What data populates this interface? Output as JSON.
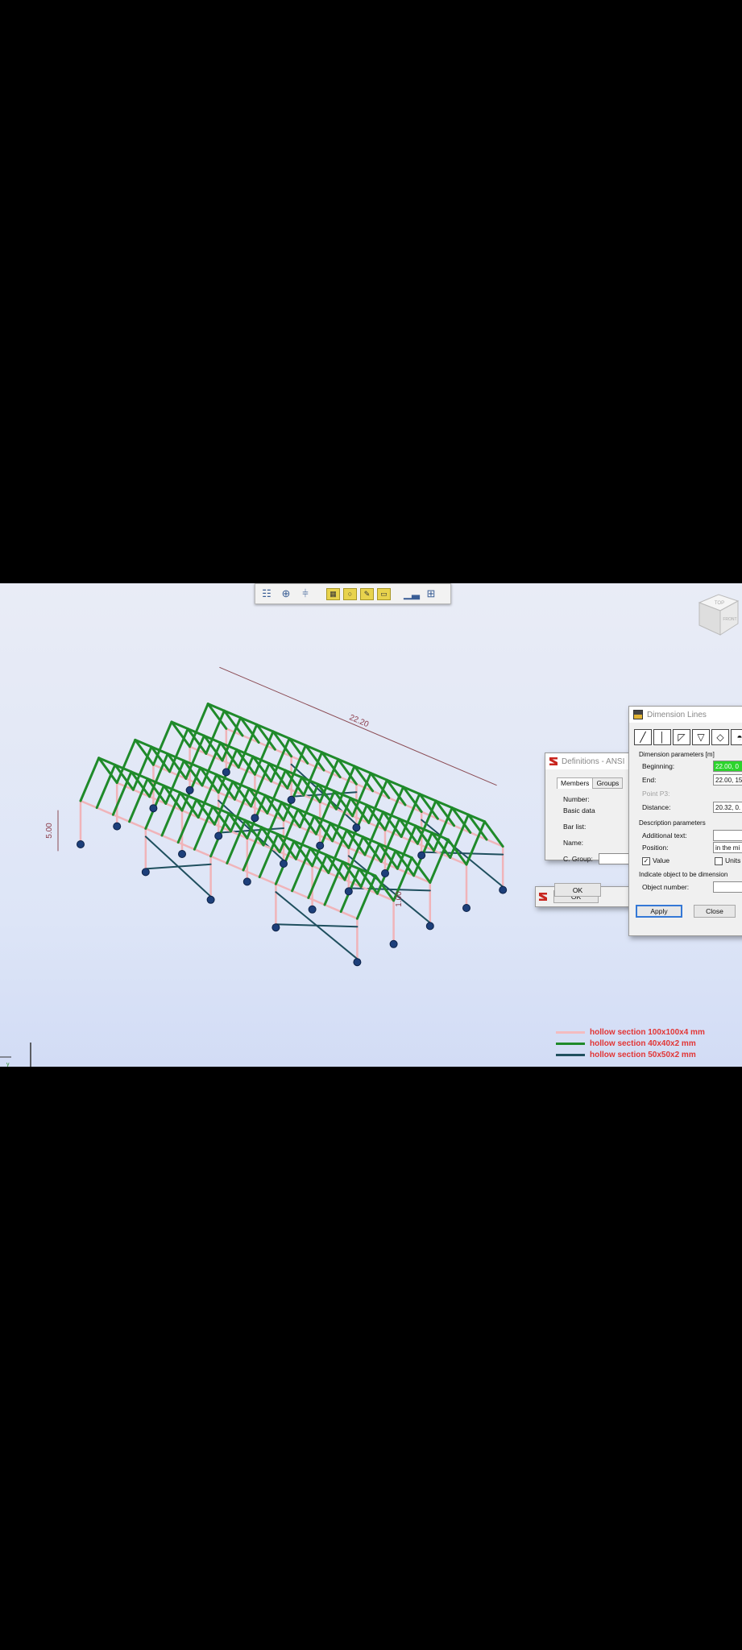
{
  "toolbar": {
    "icons": [
      "grid-icon",
      "node-icon",
      "bars-icon",
      "table-icon",
      "comment-icon",
      "edit-icon",
      "window-icon",
      "chart-icon",
      "frame-icon"
    ]
  },
  "viewcube": {
    "top_label": "TOP",
    "front_label": "FRONT"
  },
  "model": {
    "dim_length": "22.20",
    "dim_height": "5.00",
    "dim_small": "1.00"
  },
  "definitions_window": {
    "title": "Definitions - ANSI",
    "tabs": [
      "Members",
      "Groups"
    ],
    "labels": {
      "number": "Number:",
      "basic_data": "Basic data",
      "bar_list": "Bar list:",
      "name": "Name:",
      "c_group": "C. Group:"
    },
    "ok_label": "OK"
  },
  "dimension_window": {
    "title": "Dimension Lines",
    "section_params": "Dimension parameters [m]",
    "beginning_label": "Beginning:",
    "beginning_value": "22.00, 0",
    "end_label": "End:",
    "end_value": "22.00, 15",
    "point_p3_label": "Point P3:",
    "distance_label": "Distance:",
    "distance_value": "20.32, 0.",
    "section_desc": "Description parameters",
    "additional_text_label": "Additional text:",
    "position_label": "Position:",
    "position_value": "in the mi",
    "value_label": "Value",
    "units_label": "Units",
    "section_indicate": "Indicate object to be dimension",
    "object_number_label": "Object number:",
    "apply_label": "Apply",
    "close_label": "Close"
  },
  "legend": {
    "items": [
      {
        "label": "hollow section 100x100x4 mm",
        "color": "#f4bcc0"
      },
      {
        "label": "hollow section 40x40x2 mm",
        "color": "#1f8a2a"
      },
      {
        "label": "hollow section 50x50x2 mm",
        "color": "#1f4f5e"
      }
    ]
  },
  "colors": {
    "column": "#f0b4b9",
    "truss": "#1f8a2a",
    "bracing": "#1f4f5e",
    "support": "#1d3f7a",
    "dim_line": "#8a4a52"
  }
}
